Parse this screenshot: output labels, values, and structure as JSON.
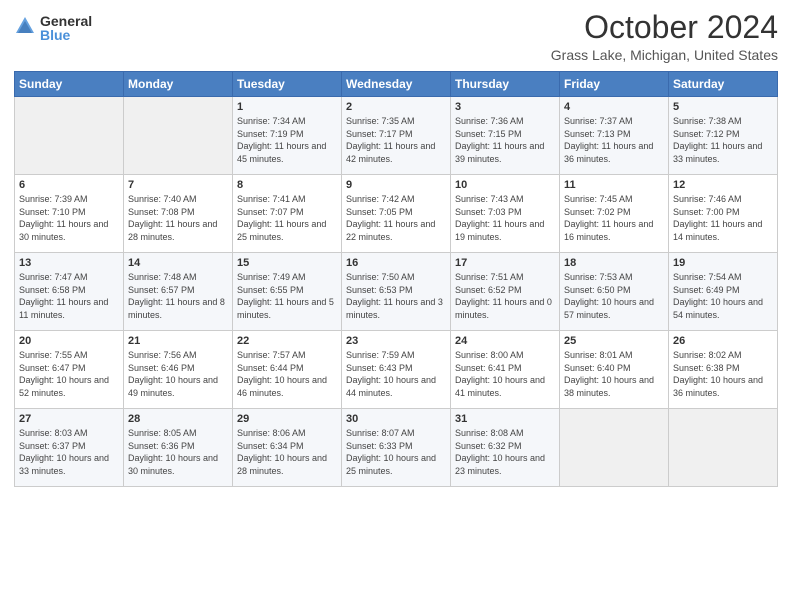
{
  "header": {
    "logo_general": "General",
    "logo_blue": "Blue",
    "title": "October 2024",
    "subtitle": "Grass Lake, Michigan, United States"
  },
  "calendar": {
    "weekdays": [
      "Sunday",
      "Monday",
      "Tuesday",
      "Wednesday",
      "Thursday",
      "Friday",
      "Saturday"
    ],
    "weeks": [
      [
        {
          "day": "",
          "info": ""
        },
        {
          "day": "",
          "info": ""
        },
        {
          "day": "1",
          "info": "Sunrise: 7:34 AM\nSunset: 7:19 PM\nDaylight: 11 hours and 45 minutes."
        },
        {
          "day": "2",
          "info": "Sunrise: 7:35 AM\nSunset: 7:17 PM\nDaylight: 11 hours and 42 minutes."
        },
        {
          "day": "3",
          "info": "Sunrise: 7:36 AM\nSunset: 7:15 PM\nDaylight: 11 hours and 39 minutes."
        },
        {
          "day": "4",
          "info": "Sunrise: 7:37 AM\nSunset: 7:13 PM\nDaylight: 11 hours and 36 minutes."
        },
        {
          "day": "5",
          "info": "Sunrise: 7:38 AM\nSunset: 7:12 PM\nDaylight: 11 hours and 33 minutes."
        }
      ],
      [
        {
          "day": "6",
          "info": "Sunrise: 7:39 AM\nSunset: 7:10 PM\nDaylight: 11 hours and 30 minutes."
        },
        {
          "day": "7",
          "info": "Sunrise: 7:40 AM\nSunset: 7:08 PM\nDaylight: 11 hours and 28 minutes."
        },
        {
          "day": "8",
          "info": "Sunrise: 7:41 AM\nSunset: 7:07 PM\nDaylight: 11 hours and 25 minutes."
        },
        {
          "day": "9",
          "info": "Sunrise: 7:42 AM\nSunset: 7:05 PM\nDaylight: 11 hours and 22 minutes."
        },
        {
          "day": "10",
          "info": "Sunrise: 7:43 AM\nSunset: 7:03 PM\nDaylight: 11 hours and 19 minutes."
        },
        {
          "day": "11",
          "info": "Sunrise: 7:45 AM\nSunset: 7:02 PM\nDaylight: 11 hours and 16 minutes."
        },
        {
          "day": "12",
          "info": "Sunrise: 7:46 AM\nSunset: 7:00 PM\nDaylight: 11 hours and 14 minutes."
        }
      ],
      [
        {
          "day": "13",
          "info": "Sunrise: 7:47 AM\nSunset: 6:58 PM\nDaylight: 11 hours and 11 minutes."
        },
        {
          "day": "14",
          "info": "Sunrise: 7:48 AM\nSunset: 6:57 PM\nDaylight: 11 hours and 8 minutes."
        },
        {
          "day": "15",
          "info": "Sunrise: 7:49 AM\nSunset: 6:55 PM\nDaylight: 11 hours and 5 minutes."
        },
        {
          "day": "16",
          "info": "Sunrise: 7:50 AM\nSunset: 6:53 PM\nDaylight: 11 hours and 3 minutes."
        },
        {
          "day": "17",
          "info": "Sunrise: 7:51 AM\nSunset: 6:52 PM\nDaylight: 11 hours and 0 minutes."
        },
        {
          "day": "18",
          "info": "Sunrise: 7:53 AM\nSunset: 6:50 PM\nDaylight: 10 hours and 57 minutes."
        },
        {
          "day": "19",
          "info": "Sunrise: 7:54 AM\nSunset: 6:49 PM\nDaylight: 10 hours and 54 minutes."
        }
      ],
      [
        {
          "day": "20",
          "info": "Sunrise: 7:55 AM\nSunset: 6:47 PM\nDaylight: 10 hours and 52 minutes."
        },
        {
          "day": "21",
          "info": "Sunrise: 7:56 AM\nSunset: 6:46 PM\nDaylight: 10 hours and 49 minutes."
        },
        {
          "day": "22",
          "info": "Sunrise: 7:57 AM\nSunset: 6:44 PM\nDaylight: 10 hours and 46 minutes."
        },
        {
          "day": "23",
          "info": "Sunrise: 7:59 AM\nSunset: 6:43 PM\nDaylight: 10 hours and 44 minutes."
        },
        {
          "day": "24",
          "info": "Sunrise: 8:00 AM\nSunset: 6:41 PM\nDaylight: 10 hours and 41 minutes."
        },
        {
          "day": "25",
          "info": "Sunrise: 8:01 AM\nSunset: 6:40 PM\nDaylight: 10 hours and 38 minutes."
        },
        {
          "day": "26",
          "info": "Sunrise: 8:02 AM\nSunset: 6:38 PM\nDaylight: 10 hours and 36 minutes."
        }
      ],
      [
        {
          "day": "27",
          "info": "Sunrise: 8:03 AM\nSunset: 6:37 PM\nDaylight: 10 hours and 33 minutes."
        },
        {
          "day": "28",
          "info": "Sunrise: 8:05 AM\nSunset: 6:36 PM\nDaylight: 10 hours and 30 minutes."
        },
        {
          "day": "29",
          "info": "Sunrise: 8:06 AM\nSunset: 6:34 PM\nDaylight: 10 hours and 28 minutes."
        },
        {
          "day": "30",
          "info": "Sunrise: 8:07 AM\nSunset: 6:33 PM\nDaylight: 10 hours and 25 minutes."
        },
        {
          "day": "31",
          "info": "Sunrise: 8:08 AM\nSunset: 6:32 PM\nDaylight: 10 hours and 23 minutes."
        },
        {
          "day": "",
          "info": ""
        },
        {
          "day": "",
          "info": ""
        }
      ]
    ]
  }
}
